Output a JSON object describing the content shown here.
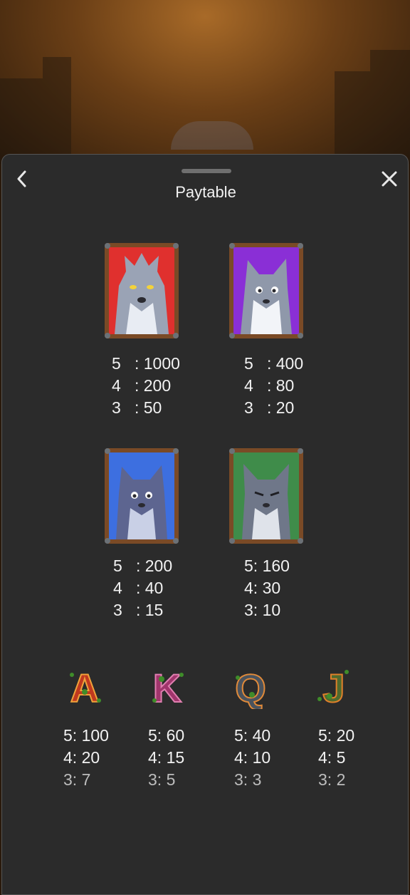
{
  "header": {
    "title": "Paytable"
  },
  "colors": {
    "panel": "#2b2b2b",
    "text": "#f2f2f2",
    "frame_wood": "#7a4a26",
    "card_red": "#e0302e",
    "card_purple": "#8a2fd6",
    "card_blue": "#3d6fe0",
    "card_green": "#3f8c4a"
  },
  "symbols": [
    {
      "icon": "gray-wolf-red-icon",
      "pays": [
        "5   : 1000",
        "4   : 200",
        "3   : 50"
      ]
    },
    {
      "icon": "white-wolf-purple-icon",
      "pays": [
        "5   : 400",
        "4   : 80",
        "3   : 20"
      ]
    },
    {
      "icon": "blue-wolf-icon",
      "pays": [
        "5   : 200",
        "4   : 40",
        "3   : 15"
      ]
    },
    {
      "icon": "gray-wolf-green-icon",
      "pays": [
        "5: 160",
        "4: 30",
        "3: 10"
      ]
    }
  ],
  "letters": [
    {
      "glyph": "A",
      "pays": [
        "5: 100",
        "4: 20",
        "3: 7"
      ]
    },
    {
      "glyph": "K",
      "pays": [
        "5: 60",
        "4: 15",
        "3: 5"
      ]
    },
    {
      "glyph": "Q",
      "pays": [
        "5: 40",
        "4: 10",
        "3: 3"
      ]
    },
    {
      "glyph": "J",
      "pays": [
        "5: 20",
        "4: 5",
        "3: 2"
      ]
    }
  ]
}
